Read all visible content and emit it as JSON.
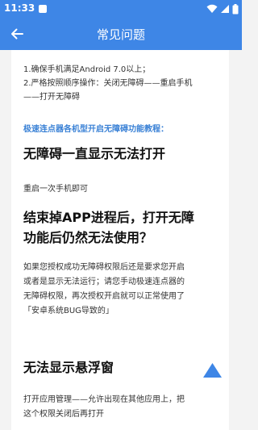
{
  "status_bar": {
    "time": "11:33",
    "icons": [
      "notification-icon",
      "wifi-icon",
      "signal-icon",
      "battery-icon"
    ]
  },
  "app_bar": {
    "title": "常见问题",
    "back_icon": "arrow-left-icon"
  },
  "content": {
    "intro_line1": "1.确保手机满足Android 7.0以上；",
    "intro_line2": "2.严格按照顺序操作：关闭无障碍——重启手机",
    "intro_line3": "——打开无障碍",
    "tutorial_link": "极速连点器各机型开启无障碍功能教程：",
    "section1_title": "无障碍一直显示无法打开",
    "section1_body": "重启一次手机即可",
    "section2_title_line1": "结束掉APP进程后，打开无障",
    "section2_title_line2": "功能后仍然无法使用？",
    "section2_body_line1": "如果您授权成功无障碍权限后还是要求您开启",
    "section2_body_line2": "或者是显示无法运行；请您手动极速连点器的",
    "section2_body_line3": "无障碍权限，再次授权开启就可以正常使用了",
    "section2_body_line4": "「安卓系统BUG导致的」",
    "section3_title": "无法显示悬浮窗",
    "section3_body_line1": "打开应用管理——允许出现在其他应用上，把",
    "section3_body_line2": "这个权限关闭后再打开",
    "scroll_top_icon": "triangle-up-icon"
  },
  "colors": {
    "accent": "#3e86e6",
    "link": "#3b82d6",
    "background": "#f3f3f3"
  }
}
